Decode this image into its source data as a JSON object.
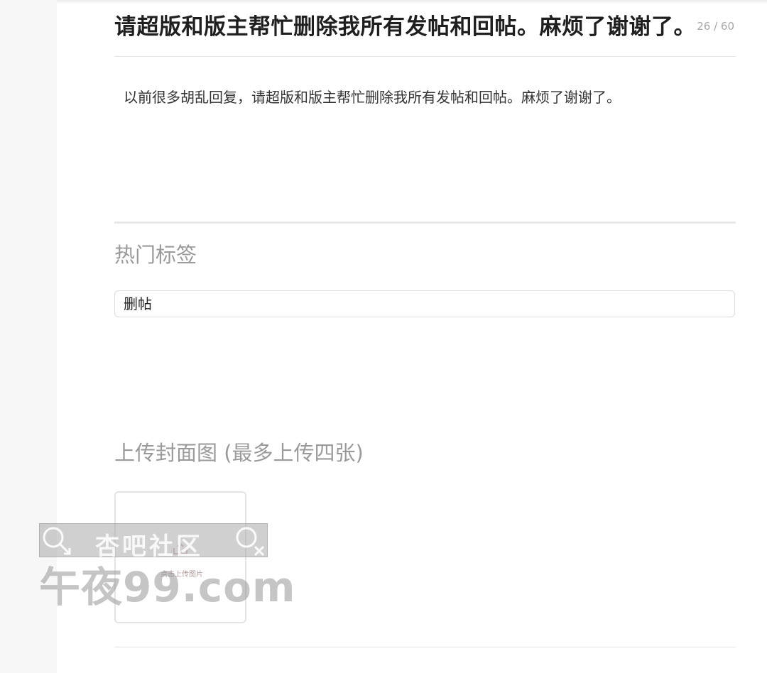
{
  "post": {
    "title": "请超版和版主帮忙删除我所有发帖和回帖。麻烦了谢谢了。",
    "char_count": "26 / 60",
    "body": "以前很多胡乱回复，请超版和版主帮忙删除我所有发帖和回帖。麻烦了谢谢了。"
  },
  "tags_section": {
    "title": "热门标签",
    "input_value": "删帖"
  },
  "upload_section": {
    "title": "上传封面图 (最多上传四张)",
    "button_label": "点击上传图片",
    "icon": "upload-icon"
  },
  "watermark": {
    "banner_text": "杏吧社区",
    "site_text": "午夜99.com"
  },
  "colors": {
    "title": "#1f1f1f",
    "muted": "#9a9a9a",
    "border": "#dcdcdc"
  }
}
